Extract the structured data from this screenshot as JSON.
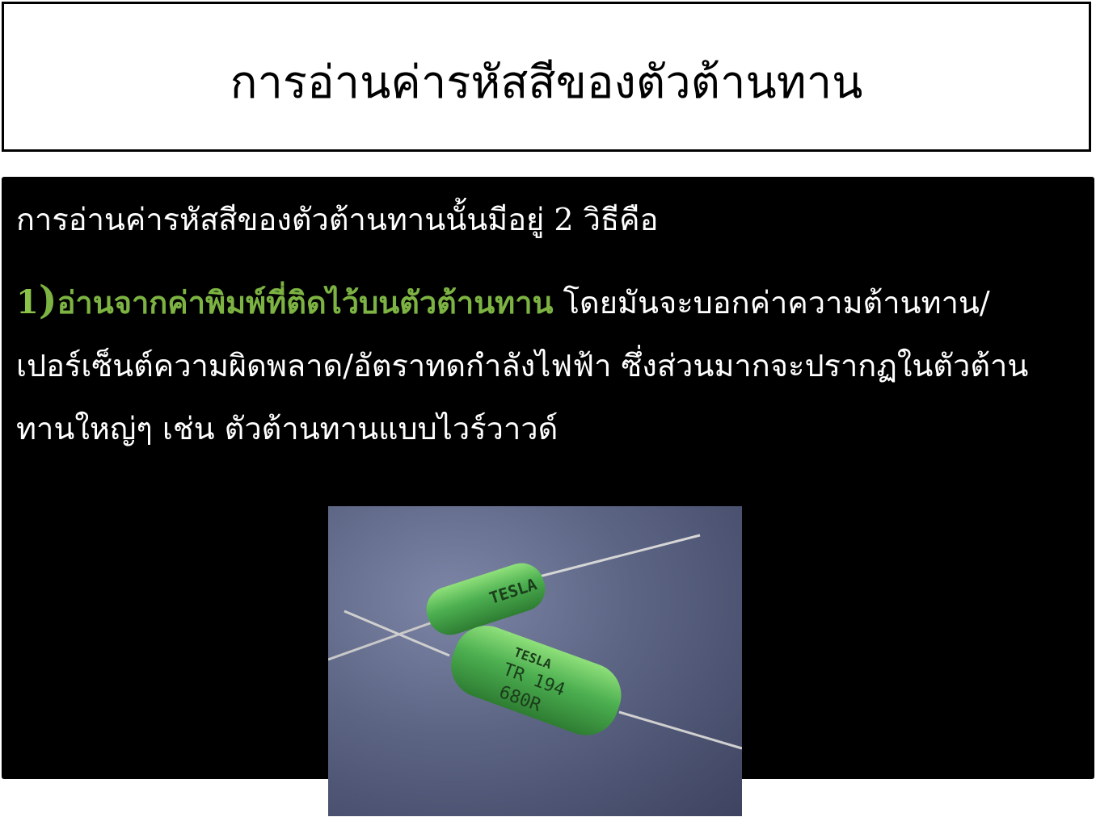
{
  "slide": {
    "title": "การอ่านค่ารหัสสีของตัวต้านทาน",
    "intro": "การอ่านค่ารหัสสีของตัวต้านทานนั้นมีอยู่ 2 วิธีคือ",
    "item1": {
      "number": "1",
      "paren": ")",
      "heading": "อ่านจากค่าพิมพ์ที่ติดไว้บนตัวต้านทาน",
      "body": " โดยมันจะบอกค่าความต้านทาน/เปอร์เซ็นต์ความผิดพลาด/อัตราทดกำลังไฟฟ้า ซึ่งส่วนมากจะปรากฏในตัวต้านทานใหญ่ๆ เช่น ตัวต้านทานแบบไวร์วาวด์"
    },
    "photo": {
      "resistor_back_text": "TESLA",
      "resistor_front_line1": "TESLA",
      "resistor_front_line2": "TR 194",
      "resistor_front_line3": "680R"
    }
  },
  "colors": {
    "highlight": "#7cb342",
    "content_bg": "#000000",
    "resistor_green": "#4caf50"
  }
}
